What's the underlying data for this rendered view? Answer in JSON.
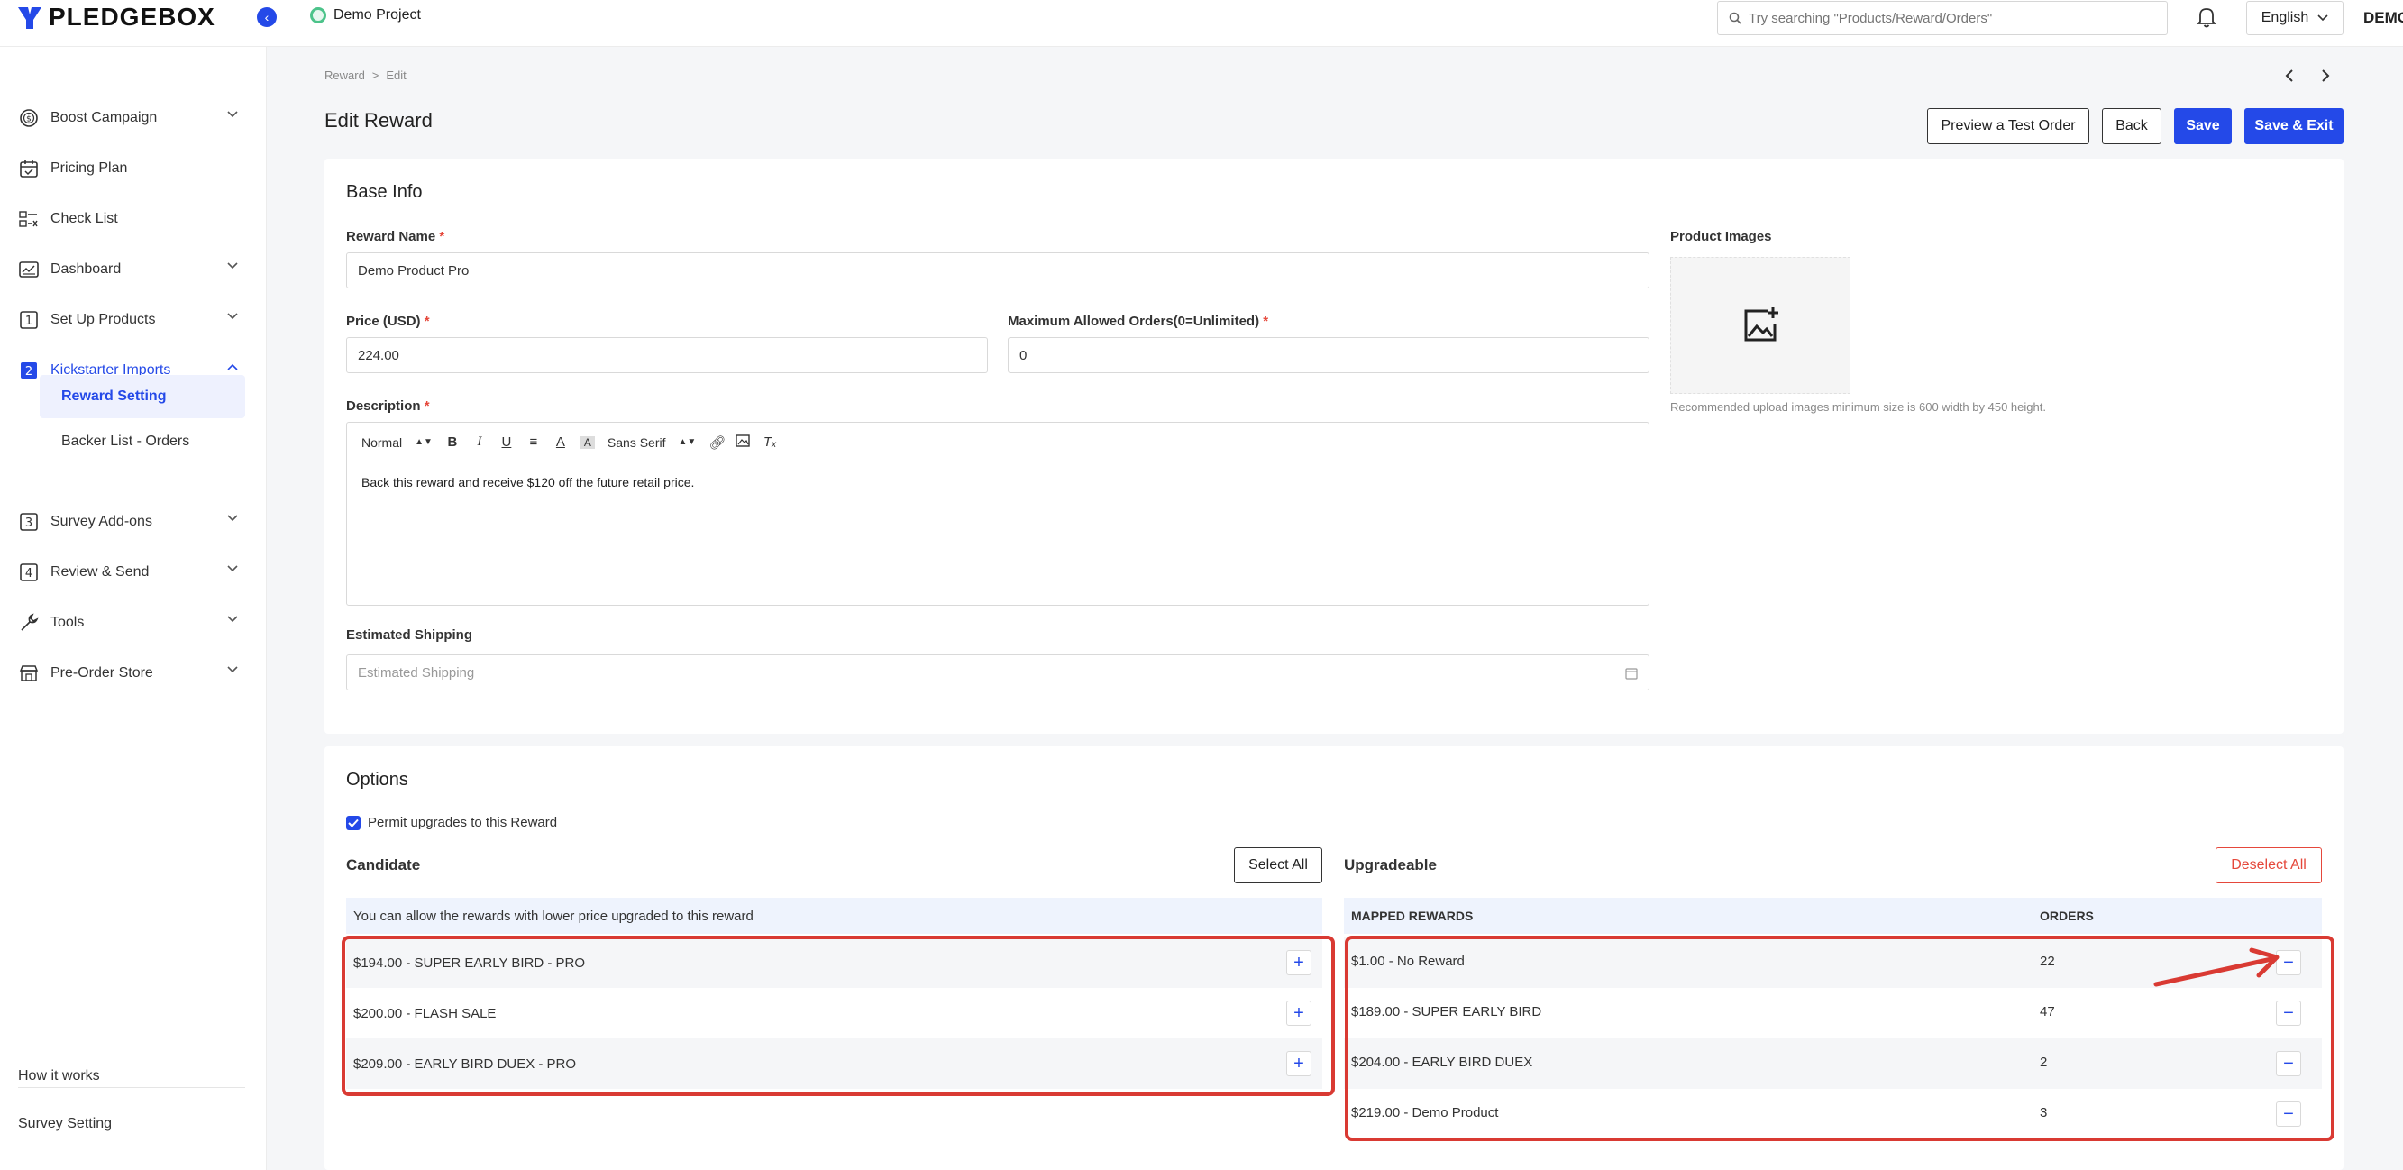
{
  "app": {
    "logo_text": "PLEDGEBOX",
    "project_name": "Demo Project",
    "user_name": "DEMO",
    "language": "English"
  },
  "search": {
    "placeholder": "Try searching \"Products/Reward/Orders\""
  },
  "sidebar": {
    "items": [
      {
        "label": "Boost Campaign",
        "icon": "dollar-circle-icon",
        "chevron": "down"
      },
      {
        "label": "Pricing Plan",
        "icon": "calendar-check-icon",
        "chevron": ""
      },
      {
        "label": "Check List",
        "icon": "checklist-icon",
        "chevron": ""
      },
      {
        "label": "Dashboard",
        "icon": "chart-icon",
        "chevron": "down"
      },
      {
        "label": "Set Up Products",
        "icon": "step-1-icon",
        "chevron": "down"
      },
      {
        "label": "Kickstarter Imports",
        "icon": "step-2-icon",
        "chevron": "up"
      },
      {
        "label": "Survey Add-ons",
        "icon": "step-3-icon",
        "chevron": "down"
      },
      {
        "label": "Review & Send",
        "icon": "step-4-icon",
        "chevron": "down"
      },
      {
        "label": "Tools",
        "icon": "wrench-icon",
        "chevron": "down"
      },
      {
        "label": "Pre-Order Store",
        "icon": "store-icon",
        "chevron": "down"
      }
    ],
    "sub_items": [
      {
        "label": "Reward Setting"
      },
      {
        "label": "Backer List - Orders"
      }
    ],
    "bottom_links": [
      {
        "label": "How it works"
      },
      {
        "label": "Survey Setting"
      }
    ]
  },
  "breadcrumb": {
    "root": "Reward",
    "separator": ">",
    "current": "Edit"
  },
  "page": {
    "title": "Edit Reward"
  },
  "actions": {
    "preview": "Preview a Test Order",
    "back": "Back",
    "save": "Save",
    "save_exit": "Save & Exit"
  },
  "base_info": {
    "title": "Base Info",
    "reward_name_label": "Reward Name",
    "reward_name_value": "Demo Product Pro",
    "price_label": "Price (USD)",
    "price_value": "224.00",
    "max_orders_label": "Maximum Allowed Orders(0=Unlimited)",
    "max_orders_value": "0",
    "description_label": "Description",
    "description_value": "Back this reward and receive $120 off the future retail price.",
    "toolbar_heading": "Normal",
    "toolbar_font": "Sans Serif",
    "shipping_label": "Estimated Shipping",
    "shipping_placeholder": "Estimated Shipping",
    "images_label": "Product Images",
    "images_hint": "Recommended upload images minimum size is 600 width by 450 height."
  },
  "options": {
    "title": "Options",
    "permit_label": "Permit upgrades to this Reward",
    "permit_checked": true,
    "candidate_title": "Candidate",
    "select_all": "Select All",
    "candidate_info": "You can allow the rewards with lower price upgraded to this reward",
    "candidates": [
      {
        "label": "$194.00 - SUPER EARLY BIRD - PRO"
      },
      {
        "label": "$200.00 - FLASH SALE"
      },
      {
        "label": "$209.00 - EARLY BIRD DUEX - PRO"
      }
    ],
    "upgradeable_title": "Upgradeable",
    "deselect_all": "Deselect All",
    "col_mapped": "MAPPED REWARDS",
    "col_orders": "ORDERS",
    "mapped": [
      {
        "reward": "$1.00 - No Reward",
        "orders": "22"
      },
      {
        "reward": "$189.00 - SUPER EARLY BIRD",
        "orders": "47"
      },
      {
        "reward": "$204.00 - EARLY BIRD DUEX",
        "orders": "2"
      },
      {
        "reward": "$219.00 - Demo Product",
        "orders": "3"
      }
    ]
  },
  "colors": {
    "accent": "#2449e8",
    "danger": "#e5483b",
    "highlight": "#d93a33"
  }
}
